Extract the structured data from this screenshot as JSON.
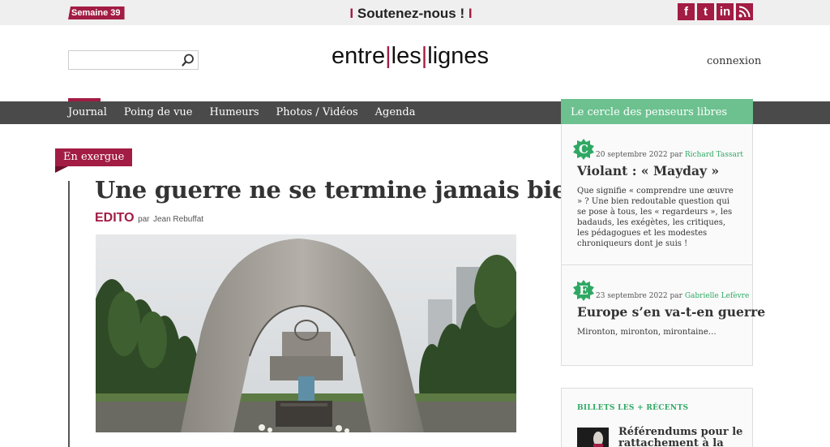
{
  "topbar": {
    "week_badge": "Semaine 39",
    "support_text": "Soutenez-nous !",
    "support_bar": "I",
    "social": [
      {
        "icon": "facebook-icon",
        "glyph": "f"
      },
      {
        "icon": "tumblr-icon",
        "glyph": "t"
      },
      {
        "icon": "linkedin-icon",
        "glyph": "in"
      },
      {
        "icon": "rss-icon",
        "glyph": ""
      }
    ]
  },
  "header": {
    "search": {
      "value": "",
      "placeholder": ""
    },
    "logo": {
      "part1": "entre",
      "part2": "les",
      "part3": "lignes",
      "separator": "|"
    },
    "login": "connexion"
  },
  "nav": {
    "items": [
      "Journal",
      "Poing de vue",
      "Humeurs",
      "Photos / Vidéos",
      "Agenda"
    ],
    "active": "Journal"
  },
  "sidebar": {
    "heading": "Le cercle des penseurs libres",
    "posts": [
      {
        "badge_letter": "C",
        "date": "20 septembre 2022",
        "by": "par",
        "author": "Richard Tassart",
        "title": "Violant : « Mayday »",
        "excerpt": "Que signifie « comprendre une œuvre » ? Une bien redoutable question qui se pose à tous, les « regardeurs », les badauds, les exégètes, les critiques, les pédagogues et les modestes chroniqueurs dont je suis !"
      },
      {
        "badge_letter": "E",
        "date": "23 septembre 2022",
        "by": "par",
        "author": "Gabrielle Lefèvre",
        "title": "Europe s’en va-t-en guerre",
        "excerpt": "Mironton, mironton, mirontaine…"
      }
    ],
    "billets": {
      "heading": "BILLETS LES + RÉCENTS",
      "first_title": "Référendums pour le rattachement à la Russie"
    }
  },
  "article": {
    "label": "En exergue",
    "title": "Une guerre ne se termine jamais bien",
    "category": "EDITO",
    "by": "par",
    "author": "Jean Rebuffat"
  },
  "colors": {
    "brand": "#a21c43",
    "nav_bg": "#4a4a4a",
    "green": "#6cc18f",
    "green_text": "#2fa863"
  }
}
